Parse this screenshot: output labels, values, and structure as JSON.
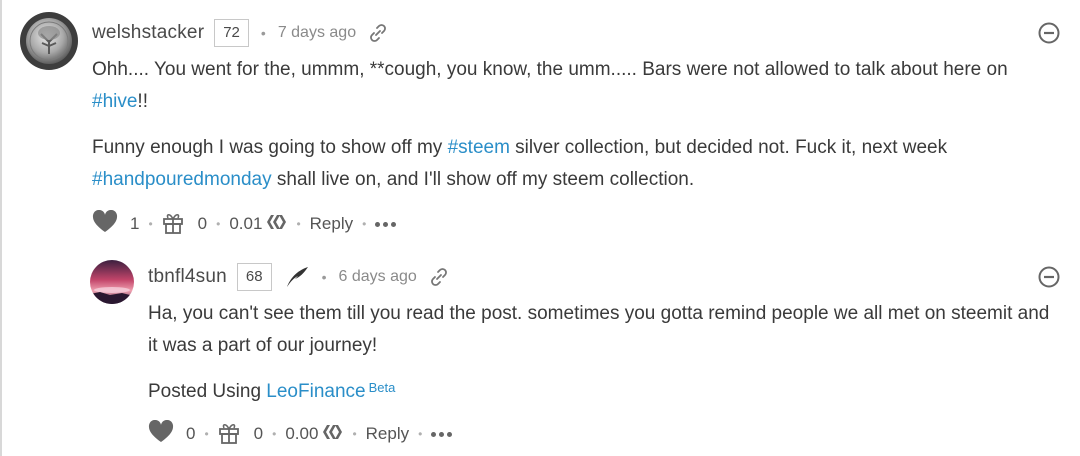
{
  "comments": [
    {
      "author": "welshstacker",
      "reputation": "72",
      "time": "7 days ago",
      "paragraphs": [
        [
          {
            "text": "Ohh.... You went for the, ummm, **cough, you know, the umm..... Bars were not allowed to talk about here on ",
            "link": false
          },
          {
            "text": "#hive",
            "link": true
          },
          {
            "text": "!!",
            "link": false
          }
        ],
        [
          {
            "text": "Funny enough I was going to show off my ",
            "link": false
          },
          {
            "text": "#steem",
            "link": true
          },
          {
            "text": " silver collection, but decided not. Fuck it, next week ",
            "link": false
          },
          {
            "text": "#handpouredmonday",
            "link": true
          },
          {
            "text": " shall live on, and I'll show off my steem collection.",
            "link": false
          }
        ]
      ],
      "votes": "1",
      "gifts": "0",
      "payout": "0.01",
      "reply_label": "Reply"
    },
    {
      "author": "tbnfl4sun",
      "reputation": "68",
      "time": "6 days ago",
      "paragraphs": [
        [
          {
            "text": "Ha, you can't see them till you read the post. sometimes you gotta remind people we all met on steemit and it was a part of our journey!",
            "link": false
          }
        ],
        [
          {
            "text": "Posted Using ",
            "link": false
          },
          {
            "text": "LeoFinance",
            "link": true
          },
          {
            "text": "Beta",
            "link": true,
            "sup": true
          }
        ]
      ],
      "votes": "0",
      "gifts": "0",
      "payout": "0.00",
      "reply_label": "Reply"
    }
  ],
  "icons": {
    "upvote": "heart-icon",
    "gift": "gift-icon",
    "currency": "hive-logo-icon",
    "link": "link-icon",
    "collapse": "collapse-minus-icon",
    "more": "more-dots-icon",
    "badge": "quill-icon"
  },
  "colors": {
    "link": "#2a8ec8",
    "text": "#3a3a3a",
    "muted": "#8a8a8a"
  }
}
